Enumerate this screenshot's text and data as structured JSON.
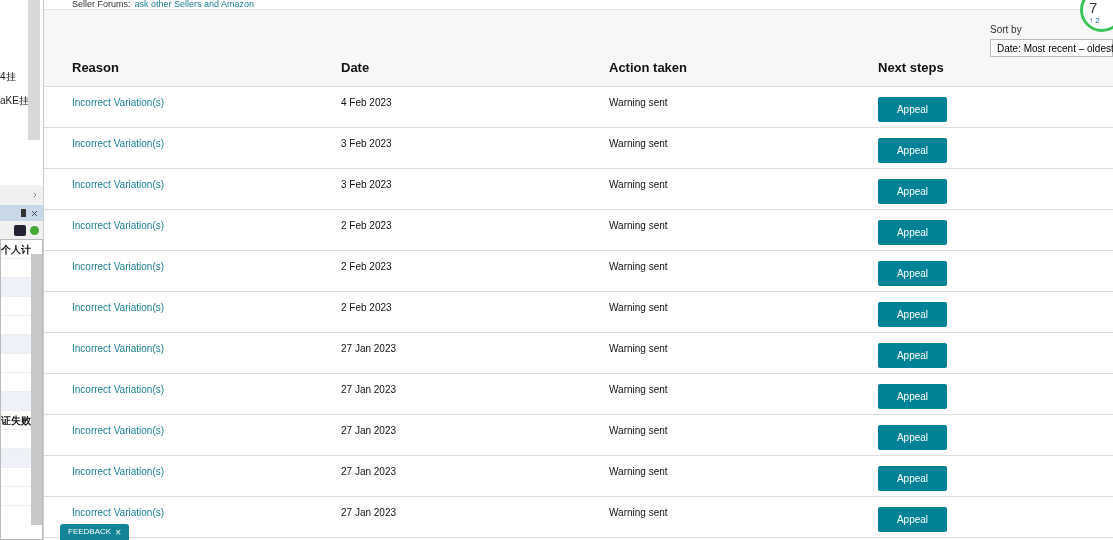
{
  "top_link": {
    "label": "Seller Forums:",
    "link": "ask other Sellers and Amazon"
  },
  "score_badge": {
    "value": "7",
    "delta": "↑ 2"
  },
  "sort": {
    "label": "Sort by",
    "value": "Date: Most recent – oldest"
  },
  "table": {
    "columns": [
      "Reason",
      "Date",
      "Action taken",
      "Next steps"
    ],
    "rows": [
      {
        "reason": "Incorrect Variation(s)",
        "date": "4 Feb 2023",
        "action": "Warning sent",
        "button": "Appeal"
      },
      {
        "reason": "Incorrect Variation(s)",
        "date": "3 Feb 2023",
        "action": "Warning sent",
        "button": "Appeal"
      },
      {
        "reason": "Incorrect Variation(s)",
        "date": "3 Feb 2023",
        "action": "Warning sent",
        "button": "Appeal"
      },
      {
        "reason": "Incorrect Variation(s)",
        "date": "2 Feb 2023",
        "action": "Warning sent",
        "button": "Appeal"
      },
      {
        "reason": "Incorrect Variation(s)",
        "date": "2 Feb 2023",
        "action": "Warning sent",
        "button": "Appeal"
      },
      {
        "reason": "Incorrect Variation(s)",
        "date": "2 Feb 2023",
        "action": "Warning sent",
        "button": "Appeal"
      },
      {
        "reason": "Incorrect Variation(s)",
        "date": "27 Jan 2023",
        "action": "Warning sent",
        "button": "Appeal"
      },
      {
        "reason": "Incorrect Variation(s)",
        "date": "27 Jan 2023",
        "action": "Warning sent",
        "button": "Appeal"
      },
      {
        "reason": "Incorrect Variation(s)",
        "date": "27 Jan 2023",
        "action": "Warning sent",
        "button": "Appeal"
      },
      {
        "reason": "Incorrect Variation(s)",
        "date": "27 Jan 2023",
        "action": "Warning sent",
        "button": "Appeal"
      },
      {
        "reason": "Incorrect Variation(s)",
        "date": "27 Jan 2023",
        "action": "Warning sent",
        "button": "Appeal"
      }
    ]
  },
  "side_panel": {
    "top_items": [
      "4挂",
      "aKE挂"
    ],
    "list_items": [
      "个人计",
      "证失败"
    ]
  },
  "feedback": {
    "label": "FEEDBACK",
    "close": "×"
  }
}
